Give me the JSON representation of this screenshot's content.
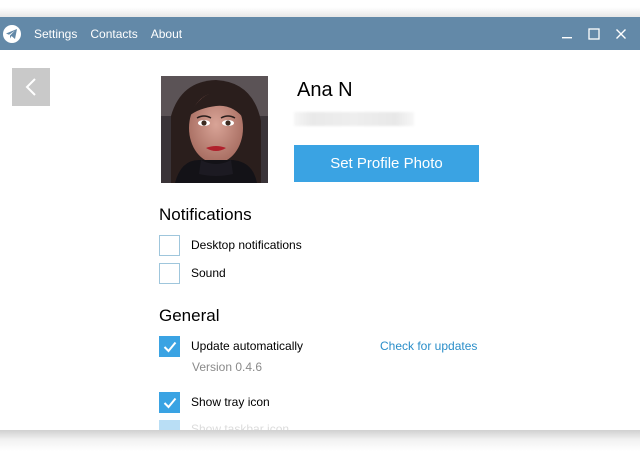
{
  "titlebar": {
    "menu": [
      "Settings",
      "Contacts",
      "About"
    ],
    "logo_icon": "paper-plane-icon",
    "controls": [
      "minimize-icon",
      "maximize-icon",
      "close-icon"
    ]
  },
  "profile": {
    "name": "Ana N",
    "set_photo_label": "Set Profile Photo",
    "back_icon": "chevron-left-icon"
  },
  "notifications": {
    "title": "Notifications",
    "items": [
      {
        "label": "Desktop notifications",
        "checked": false
      },
      {
        "label": "Sound",
        "checked": false
      }
    ]
  },
  "general": {
    "title": "General",
    "update_label": "Update automatically",
    "update_checked": true,
    "check_updates_link": "Check for updates",
    "version": "Version 0.4.6",
    "tray_label": "Show tray icon",
    "tray_checked": true,
    "taskbar_label": "Show taskbar icon",
    "taskbar_checked": true
  },
  "colors": {
    "titlebar": "#6389a8",
    "accent": "#3aa3e3",
    "link": "#2a8ec9"
  }
}
